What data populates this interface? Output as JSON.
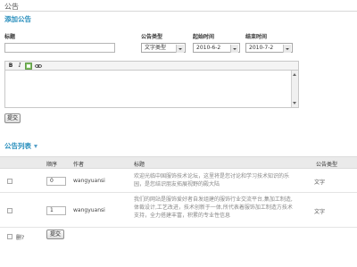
{
  "page": {
    "title": "公告"
  },
  "add_section": {
    "title": "添加公告",
    "fields": {
      "title_label": "标题",
      "title_value": "",
      "type_label": "公告类型",
      "type_value": "文字类型",
      "start_label": "起始时间",
      "start_value": "2010-6-2",
      "end_label": "结束时间",
      "end_value": "2010-7-2"
    },
    "toolbar": {
      "bold": "B",
      "italic": "I"
    },
    "editor_value": "",
    "submit_label": "提交"
  },
  "list_section": {
    "title": "公告列表",
    "columns": [
      "顺序",
      "作者",
      "标题",
      "公告类型"
    ],
    "rows": [
      {
        "order": "0",
        "author": "wangyuansi",
        "title": "欢迎光临中国服饰技术论坛，这里将是您讨论和学习技术知识的乐园，是您结识朋友拓展视野的殿大陆",
        "type": "文字"
      },
      {
        "order": "1",
        "author": "wangyuansi",
        "title": "我们的网站是服饰爱好者自发组建的服饰行业交流平台,集加工制造,体裁设计,工艺改进，技术创新于一体,所代表着服饰加工制造方技术支持，全力搭建丰富，积累的专业性信息",
        "type": "文字"
      }
    ],
    "delete_label": "删?",
    "submit_label": "提交"
  },
  "colors": {
    "accent": "#2a8fbd"
  }
}
